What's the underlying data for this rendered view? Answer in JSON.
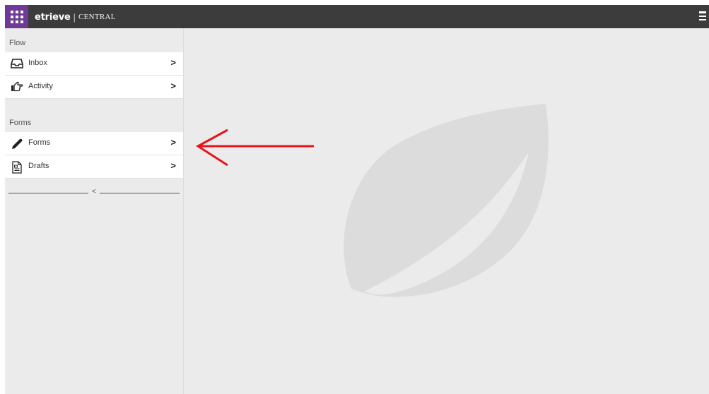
{
  "header": {
    "brand_word": "etrieve",
    "brand_separator": "|",
    "brand_product": "CENTRAL",
    "apps_icon": "grid-icon",
    "menu_icon": "hamburger-icon",
    "apps_color": "#6e3a95",
    "bar_color": "#3c3c3c"
  },
  "sidebar": {
    "sections": [
      {
        "label": "Flow",
        "items": [
          {
            "label": "Inbox",
            "icon": "inbox-tray-icon",
            "chevron": ">"
          },
          {
            "label": "Activity",
            "icon": "hand-pointer-icon",
            "chevron": ">"
          }
        ]
      },
      {
        "label": "Forms",
        "items": [
          {
            "label": "Forms",
            "icon": "pencil-icon",
            "chevron": ">"
          },
          {
            "label": "Drafts",
            "icon": "document-icon",
            "chevron": ">"
          }
        ]
      }
    ],
    "collapse_glyph": "<"
  },
  "main": {
    "watermark": "leaf-logo-icon",
    "annotation": "red-arrow-icon",
    "annotation_color": "#e8141b"
  }
}
